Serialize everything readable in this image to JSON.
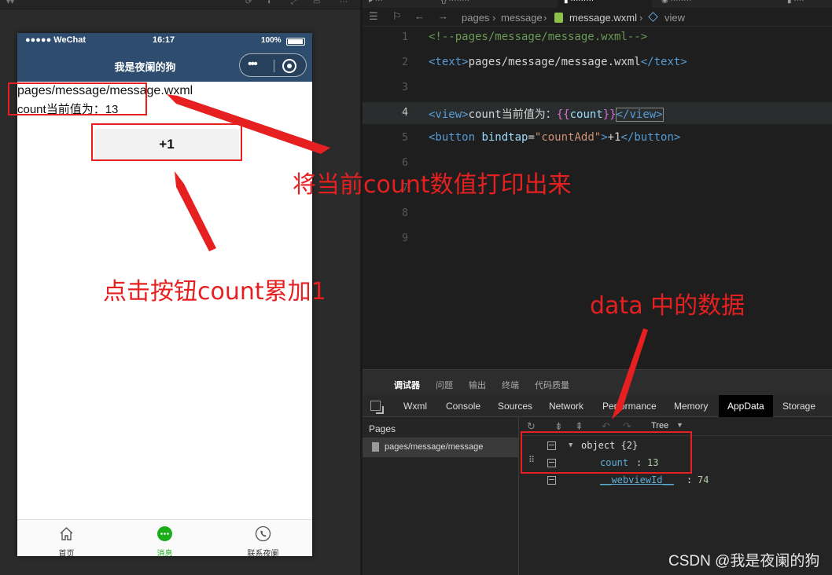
{
  "simulator": {
    "top_file_name": "",
    "status_bar": {
      "carrier": "●●●●● WeChat",
      "time": "16:17",
      "battery": "100%"
    },
    "nav_title": "我是夜阑的狗",
    "capsule_menu": "•••",
    "page_path_text": "pages/message/message.wxml",
    "count_line_text": "count当前值为：13",
    "add_button_label": "+1",
    "tabs": [
      {
        "label": "首页",
        "icon": "home-icon"
      },
      {
        "label": "消息",
        "icon": "chat-bubble-icon",
        "active": true
      },
      {
        "label": "联系夜阑",
        "icon": "phone-icon"
      }
    ]
  },
  "editor": {
    "breadcrumb": {
      "folder1": "pages",
      "folder2": "message",
      "file": "message.wxml",
      "node": "view"
    },
    "lines": [
      {
        "n": "1"
      },
      {
        "n": "2"
      },
      {
        "n": "3"
      },
      {
        "n": "4",
        "active": true
      },
      {
        "n": "5"
      },
      {
        "n": "6"
      },
      {
        "n": "7"
      },
      {
        "n": "8"
      },
      {
        "n": "9"
      }
    ],
    "code": {
      "l1": "<!--pages/message/message.wxml-->",
      "l2_open": "<text>",
      "l2_body": "pages/message/message.wxml",
      "l2_close": "</text>",
      "l4_open": "<view>",
      "l4_body": "count当前值为：",
      "l4_brace_open": "{{",
      "l4_var": "count",
      "l4_brace_close": "}}",
      "l4_close": "</view>",
      "l5_open": "<button ",
      "l5_attr": "bindtap",
      "l5_eq": "=",
      "l5_val": "\"countAdd\"",
      "l5_gt": ">",
      "l5_body": "+1",
      "l5_close": "</button>"
    }
  },
  "devtools": {
    "top_tabs": [
      "调试器",
      "问题",
      "输出",
      "终端",
      "代码质量"
    ],
    "sub_tabs": [
      "Wxml",
      "Console",
      "Sources",
      "Network",
      "Performance",
      "Memory",
      "AppData",
      "Storage"
    ],
    "active_sub_tab": "AppData",
    "pages_title": "Pages",
    "pages_item": "pages/message/message",
    "tree_mode": "Tree",
    "tree": {
      "root": "object {2}",
      "count_key": "count",
      "count_val": "13",
      "webview_key": "__webviewId__",
      "webview_val": "74"
    }
  },
  "annotations": {
    "print_count": "将当前count数值打印出来",
    "click_add": "点击按钮count累加1",
    "data_note": "data 中的数据",
    "watermark": "CSDN @我是夜阑的狗"
  },
  "colors": {
    "annotation_red": "#e62020",
    "nav_blue": "#2e4d6e",
    "active_tab_green": "#1aad19"
  }
}
